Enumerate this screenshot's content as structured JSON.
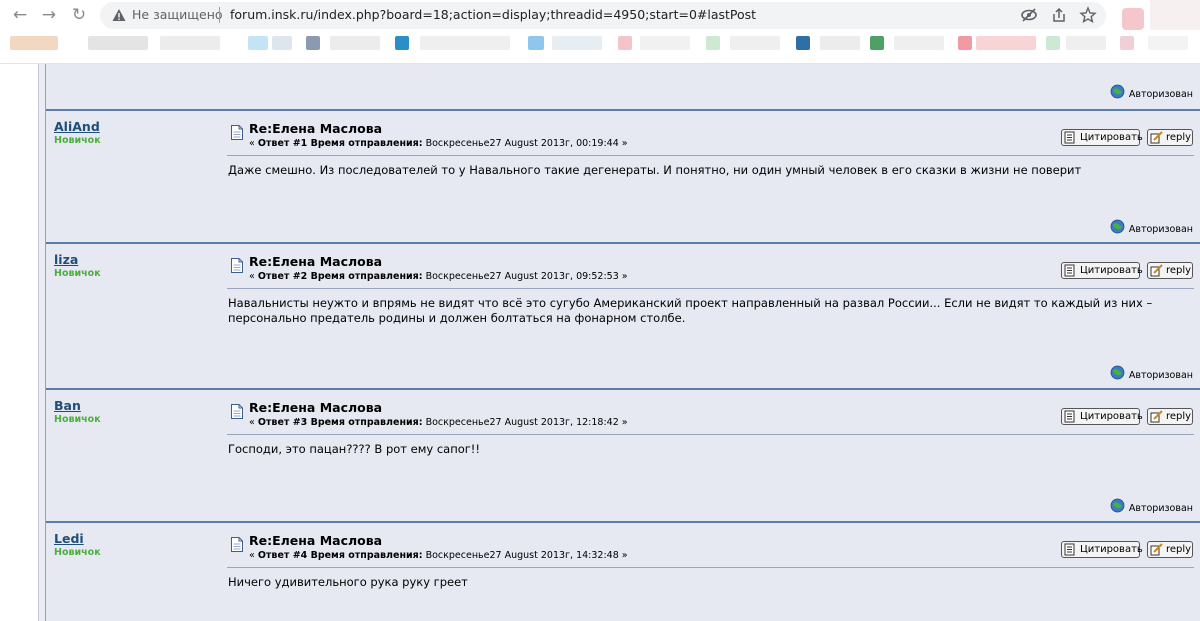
{
  "browser": {
    "security_label": "Не защищено",
    "url": "forum.insk.ru/index.php?board=18;action=display;threadid=4950;start=0#lastPost",
    "icons": [
      "back-arrow-icon",
      "forward-arrow-icon",
      "reload-icon",
      "warning-icon",
      "eye-slash-icon",
      "share-icon",
      "star-icon"
    ]
  },
  "top_fragment": {
    "status_text": "Авторизован"
  },
  "posts": [
    {
      "author": "AliAnd",
      "rank": "Новичок",
      "subject": "Re:Елена Маслова",
      "meta_prefix": "« ",
      "meta_label": "Ответ #1 Время отправления:",
      "meta_time": " Воскресенье27 August 2013г, 00:19:44 »",
      "quote_label": "Цитировать",
      "reply_label": "reply",
      "body": "Даже смешно. Из последователей то у Навального такие дегенераты. И понятно, ни один умный человек в его сказки в жизни не поверит",
      "status_text": "Авторизован"
    },
    {
      "author": "liza",
      "rank": "Новичок",
      "subject": "Re:Елена Маслова",
      "meta_prefix": "« ",
      "meta_label": "Ответ #2 Время отправления:",
      "meta_time": " Воскресенье27 August 2013г, 09:52:53 »",
      "quote_label": "Цитировать",
      "reply_label": "reply",
      "body": "Навальнисты неужто и впрямь не видят что всё это сугубо Американский проект направленный на развал России... Если не видят то каждый из них – персонально предатель родины и должен болтаться на фонарном столбе.",
      "status_text": "Авторизован"
    },
    {
      "author": "Ban",
      "rank": "Новичок",
      "subject": "Re:Елена Маслова",
      "meta_prefix": "« ",
      "meta_label": "Ответ #3 Время отправления:",
      "meta_time": " Воскресенье27 August 2013г, 12:18:42 »",
      "quote_label": "Цитировать",
      "reply_label": "reply",
      "body": "Господи, это пацан???? В рот ему сапог!!",
      "status_text": "Авторизован"
    },
    {
      "author": "Ledi",
      "rank": "Новичок",
      "subject": "Re:Елена Маслова",
      "meta_prefix": "« ",
      "meta_label": "Ответ #4 Время отправления:",
      "meta_time": " Воскресенье27 August 2013г, 14:32:48 »",
      "quote_label": "Цитировать",
      "reply_label": "reply",
      "body": "Ничего удивительного рука руку греет",
      "status_text": ""
    }
  ]
}
